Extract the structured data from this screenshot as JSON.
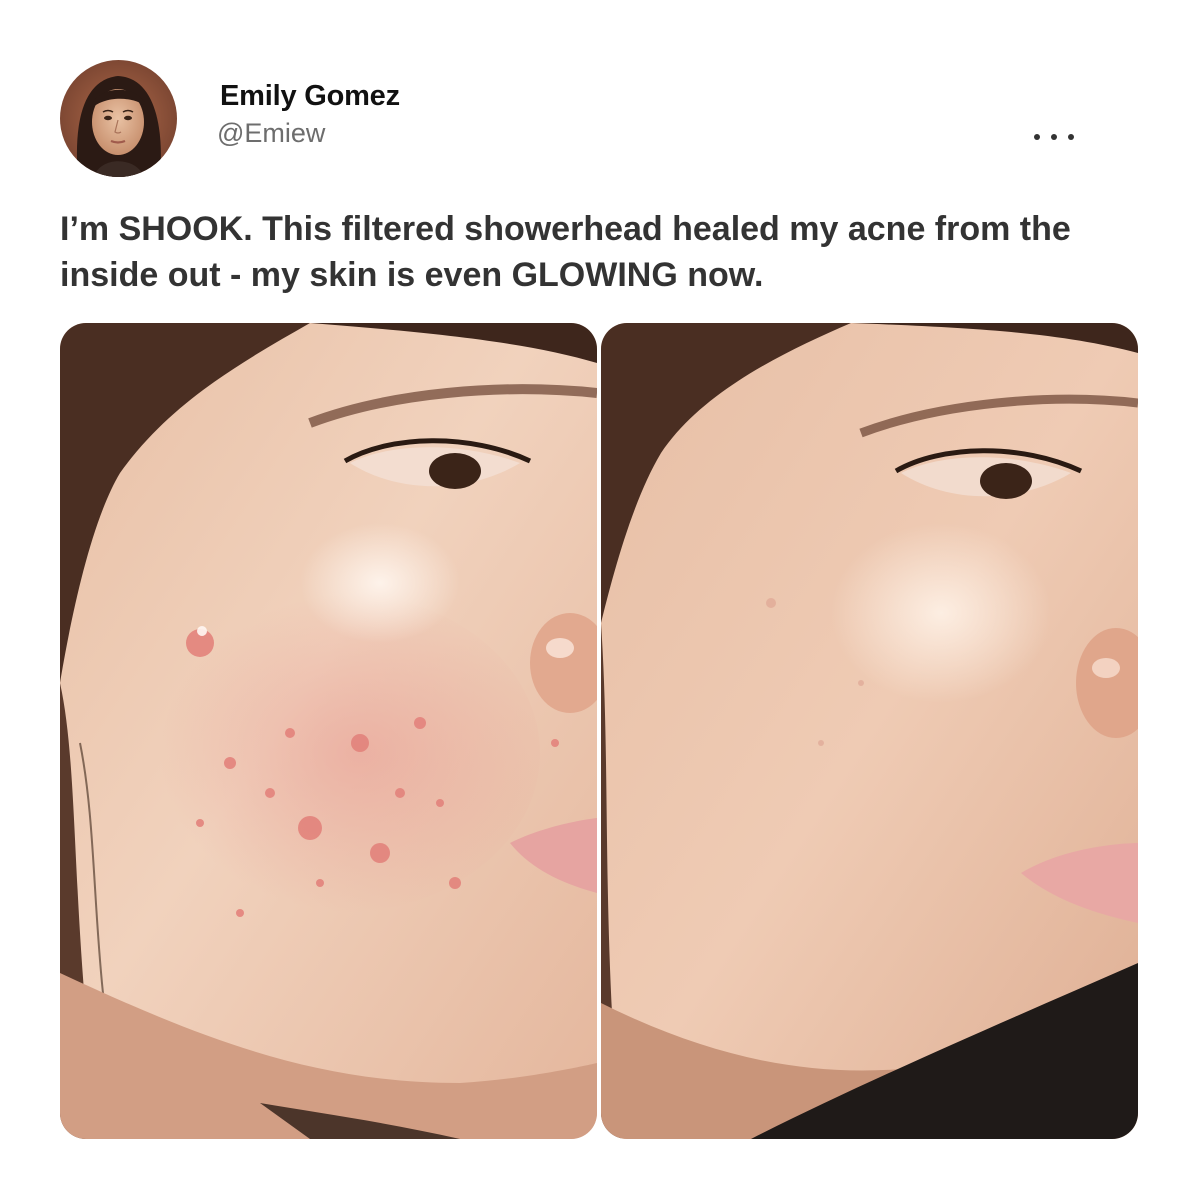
{
  "author": {
    "display_name": "Emily Gomez",
    "handle": "@Emiew",
    "avatar_icon": "profile-photo"
  },
  "post": {
    "text": "I’m SHOOK. This filtered showerhead healed my acne from the inside out - my skin is even GLOWING now."
  },
  "menu": {
    "icon": "more-horizontal-icon"
  },
  "media": [
    {
      "name": "before-photo",
      "description_icon": "face-with-acne"
    },
    {
      "name": "after-photo",
      "description_icon": "face-clear-skin"
    }
  ],
  "colors": {
    "name_text": "#111111",
    "handle_text": "#6d6d6d",
    "body_text": "#333333",
    "background": "#ffffff"
  }
}
